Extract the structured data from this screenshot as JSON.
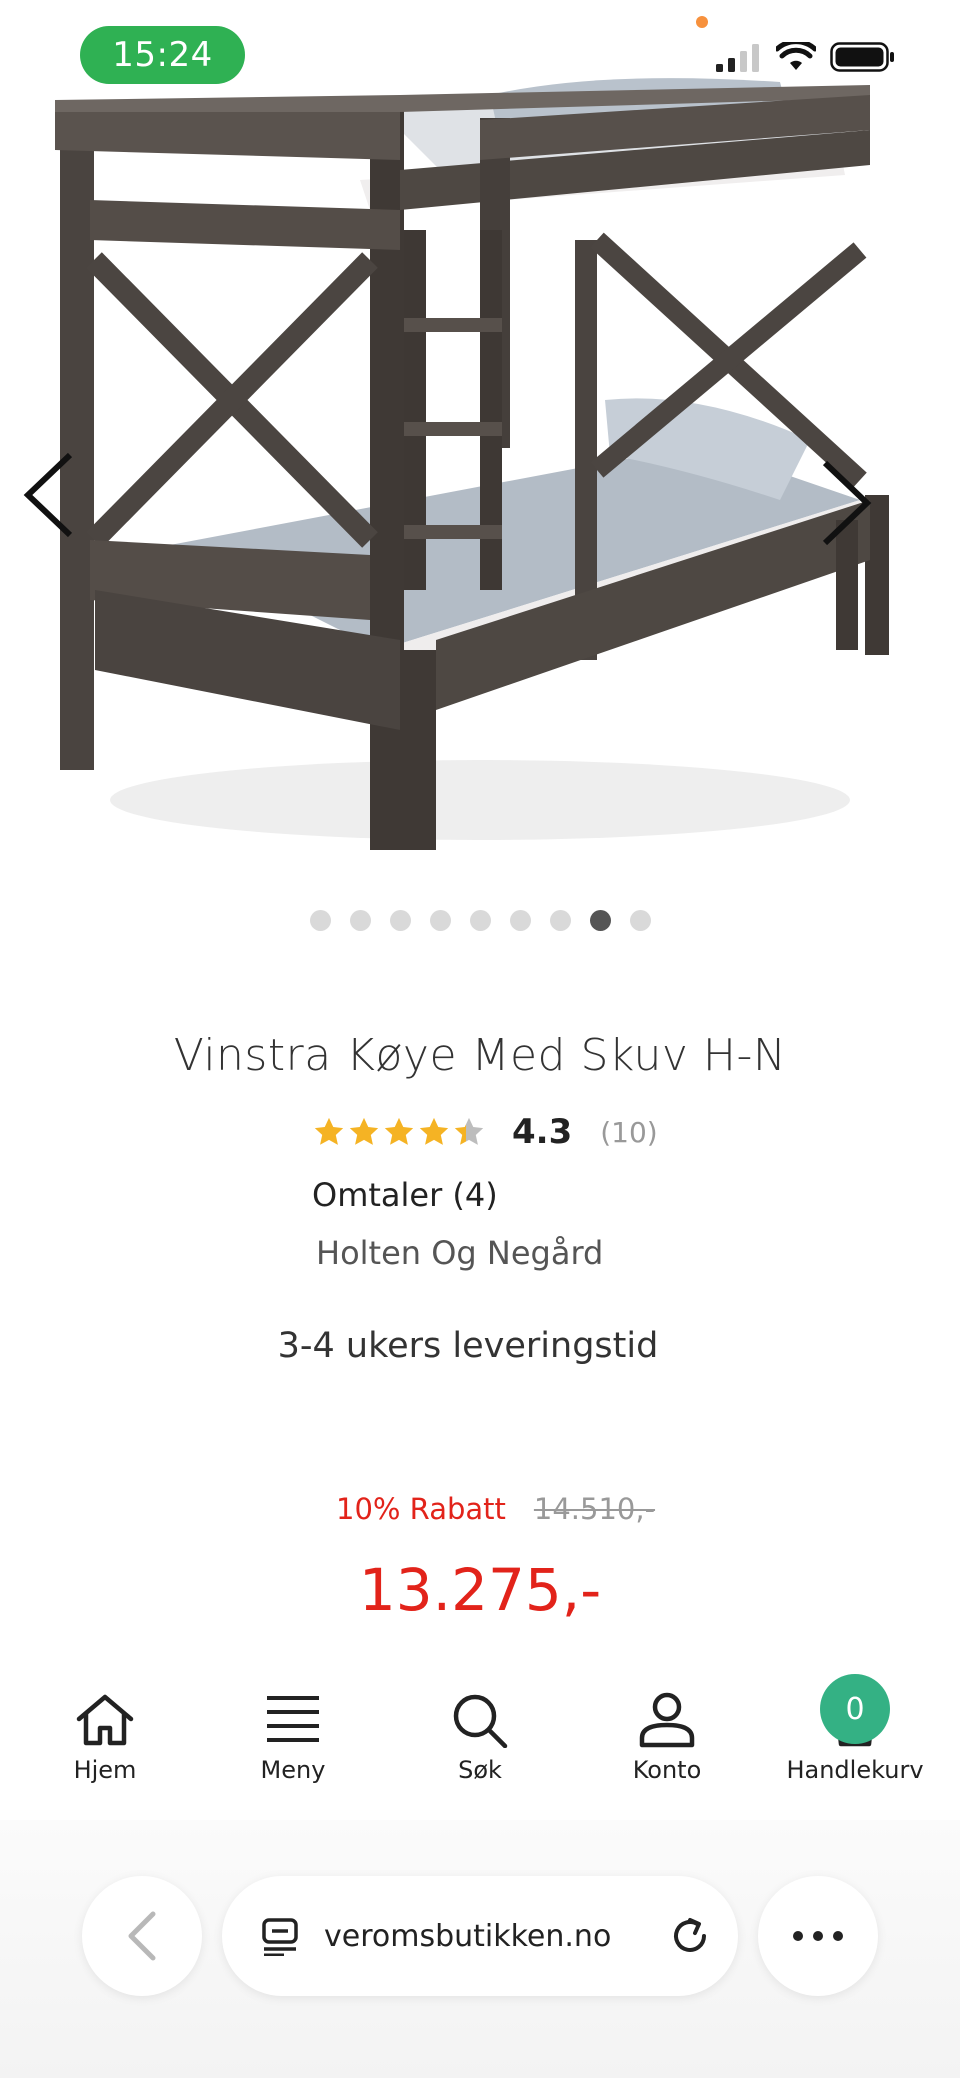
{
  "status_bar": {
    "time": "15:24"
  },
  "gallery": {
    "image_alt": "Vinstra køyeseng",
    "dot_count": 9,
    "active_index": 7
  },
  "product": {
    "title": "Vinstra Køye Med Skuv H-N",
    "rating": "4.3",
    "rating_stars": 4.3,
    "rating_count": "(10)",
    "reviews_label": "Omtaler (4)",
    "brand": "Holten Og Negård",
    "delivery": "3-4 ukers leveringstid",
    "discount": "10% Rabatt",
    "old_price": "14.510,-",
    "price": "13.275,-"
  },
  "bottom_nav": {
    "items": [
      {
        "label": "Hjem",
        "icon": "home-icon"
      },
      {
        "label": "Meny",
        "icon": "menu-icon"
      },
      {
        "label": "Søk",
        "icon": "search-icon"
      },
      {
        "label": "Konto",
        "icon": "user-icon"
      },
      {
        "label": "Handlekurv",
        "icon": "cart-icon"
      }
    ],
    "cart_count": "0"
  },
  "browser": {
    "url": "veromsbutikken.no"
  },
  "colors": {
    "accent_red": "#e2231a",
    "badge_green": "#34b184",
    "status_green": "#2fb153",
    "star_gold": "#f5b324"
  }
}
